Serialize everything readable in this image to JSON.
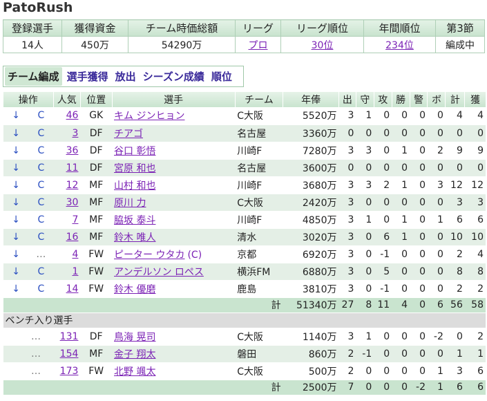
{
  "app_title": "PatoRush",
  "summary": {
    "headers": [
      "登録選手",
      "獲得資金",
      "チーム時価総額",
      "リーグ",
      "リーグ順位",
      "年間順位",
      "第3節"
    ],
    "values": [
      "14人",
      "450万",
      "54290万",
      "プロ",
      "30位",
      "234位",
      "編成中"
    ]
  },
  "nav": [
    "チーム編成",
    "選手獲得",
    "放出",
    "シーズン成績",
    "順位"
  ],
  "columns": [
    "操作",
    "人気",
    "位置",
    "選手",
    "チーム",
    "年俸",
    "出",
    "守",
    "攻",
    "勝",
    "警",
    "ボ",
    "計",
    "獲"
  ],
  "starters": [
    {
      "op1": "↓",
      "op2": "C",
      "pop": "46",
      "pos": "GK",
      "name": "キム ジンヒョン",
      "tag": "",
      "team": "C大阪",
      "salary": "5520万",
      "s": [
        "3",
        "1",
        "0",
        "0",
        "0",
        "0",
        "4",
        "4"
      ]
    },
    {
      "op1": "↓",
      "op2": "C",
      "pop": "3",
      "pos": "DF",
      "name": "チアゴ",
      "tag": "",
      "team": "名古屋",
      "salary": "3360万",
      "s": [
        "0",
        "0",
        "0",
        "0",
        "0",
        "0",
        "0",
        "0"
      ]
    },
    {
      "op1": "↓",
      "op2": "C",
      "pop": "36",
      "pos": "DF",
      "name": "谷口 彰悟",
      "tag": "",
      "team": "川崎F",
      "salary": "7280万",
      "s": [
        "3",
        "3",
        "0",
        "1",
        "0",
        "2",
        "9",
        "9"
      ]
    },
    {
      "op1": "↓",
      "op2": "C",
      "pop": "11",
      "pos": "DF",
      "name": "宮原 和也",
      "tag": "",
      "team": "名古屋",
      "salary": "3600万",
      "s": [
        "0",
        "0",
        "0",
        "0",
        "0",
        "0",
        "0",
        "0"
      ]
    },
    {
      "op1": "↓",
      "op2": "C",
      "pop": "12",
      "pos": "MF",
      "name": "山村 和也",
      "tag": "",
      "team": "川崎F",
      "salary": "3680万",
      "s": [
        "3",
        "3",
        "2",
        "1",
        "0",
        "3",
        "12",
        "12"
      ]
    },
    {
      "op1": "↓",
      "op2": "C",
      "pop": "30",
      "pos": "MF",
      "name": "原川 力",
      "tag": "",
      "team": "C大阪",
      "salary": "2420万",
      "s": [
        "3",
        "0",
        "0",
        "0",
        "0",
        "0",
        "3",
        "3"
      ]
    },
    {
      "op1": "↓",
      "op2": "C",
      "pop": "7",
      "pos": "MF",
      "name": "脇坂 泰斗",
      "tag": "",
      "team": "川崎F",
      "salary": "4850万",
      "s": [
        "3",
        "1",
        "0",
        "1",
        "0",
        "1",
        "6",
        "6"
      ]
    },
    {
      "op1": "↓",
      "op2": "C",
      "pop": "16",
      "pos": "MF",
      "name": "鈴木 唯人",
      "tag": "",
      "team": "清水",
      "salary": "3020万",
      "s": [
        "3",
        "0",
        "6",
        "1",
        "0",
        "0",
        "10",
        "10"
      ]
    },
    {
      "op1": "↓",
      "op2": "…",
      "pop": "4",
      "pos": "FW",
      "name": "ピーター ウタカ",
      "tag": "(C)",
      "team": "京都",
      "salary": "6920万",
      "s": [
        "3",
        "0",
        "-1",
        "0",
        "0",
        "0",
        "2",
        "4"
      ]
    },
    {
      "op1": "↓",
      "op2": "C",
      "pop": "1",
      "pos": "FW",
      "name": "アンデルソン ロペス",
      "tag": "",
      "team": "横浜FM",
      "salary": "6880万",
      "s": [
        "3",
        "0",
        "5",
        "0",
        "0",
        "0",
        "8",
        "8"
      ]
    },
    {
      "op1": "↓",
      "op2": "C",
      "pop": "14",
      "pos": "FW",
      "name": "鈴木 優磨",
      "tag": "",
      "team": "鹿島",
      "salary": "3810万",
      "s": [
        "3",
        "0",
        "-1",
        "0",
        "0",
        "0",
        "2",
        "2"
      ]
    }
  ],
  "starters_total": {
    "label": "計",
    "salary": "51340万",
    "s": [
      "27",
      "8",
      "11",
      "4",
      "0",
      "6",
      "56",
      "58"
    ]
  },
  "bench_title": "ベンチ入り選手",
  "bench": [
    {
      "op": "…",
      "pop": "131",
      "pos": "DF",
      "name": "鳥海 晃司",
      "team": "C大阪",
      "salary": "1140万",
      "s": [
        "3",
        "1",
        "0",
        "0",
        "0",
        "-2",
        "0",
        "2"
      ]
    },
    {
      "op": "…",
      "pop": "154",
      "pos": "MF",
      "name": "金子 翔太",
      "team": "磐田",
      "salary": "860万",
      "s": [
        "2",
        "-1",
        "0",
        "0",
        "0",
        "0",
        "1",
        "1"
      ]
    },
    {
      "op": "…",
      "pop": "173",
      "pos": "FW",
      "name": "北野 颯太",
      "team": "C大阪",
      "salary": "500万",
      "s": [
        "2",
        "0",
        "0",
        "0",
        "0",
        "1",
        "3",
        "6"
      ]
    }
  ],
  "bench_total": {
    "label": "計",
    "salary": "2500万",
    "s": [
      "7",
      "0",
      "0",
      "0",
      "-2",
      "1",
      "6",
      "6"
    ]
  }
}
